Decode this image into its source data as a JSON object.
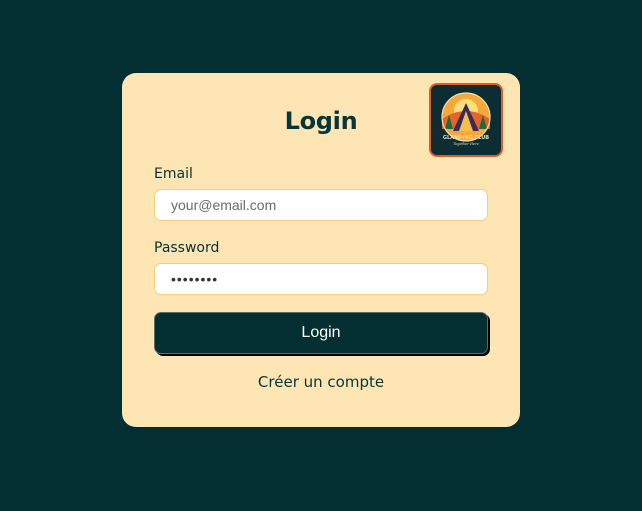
{
  "login": {
    "title": "Login",
    "email_label": "Email",
    "email_placeholder": "your@email.com",
    "password_label": "Password",
    "password_value": "••••••••",
    "submit_label": "Login",
    "register_link": "Créer un compte"
  },
  "logo": {
    "icon": "glamping-club-logo",
    "text": "GLAMPING CLUB",
    "tagline": "Together Here"
  },
  "colors": {
    "background": "#032f33",
    "card": "#fde5b4",
    "accent": "#d8612a",
    "button": "#032f33"
  }
}
